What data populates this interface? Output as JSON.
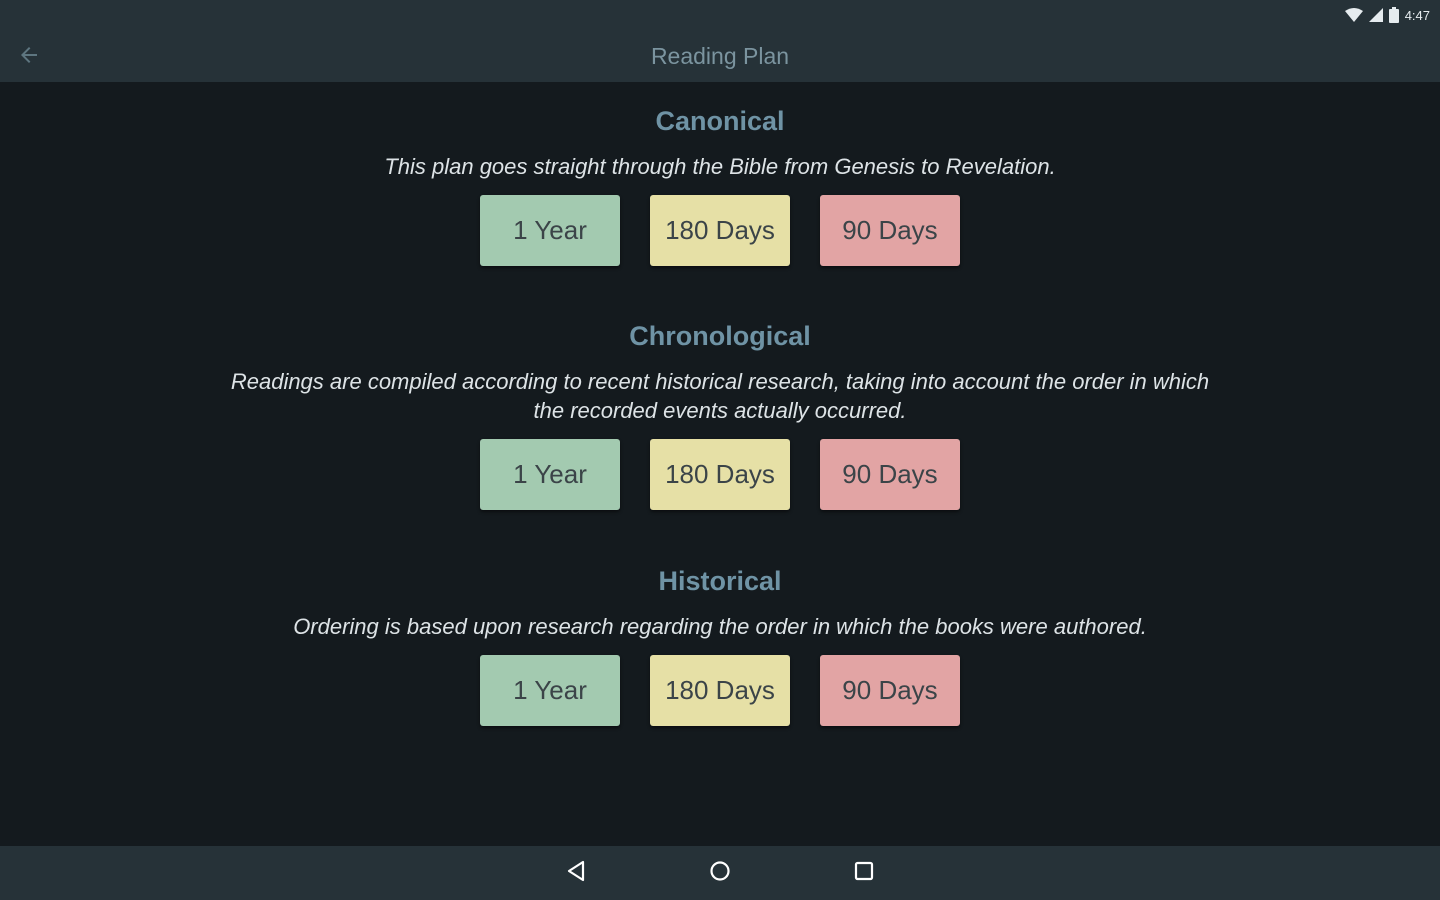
{
  "status": {
    "time": "4:47",
    "icons": [
      "wifi-icon",
      "signal-icon",
      "battery-icon"
    ]
  },
  "appbar": {
    "title": "Reading Plan",
    "back_icon": "arrow-back-icon"
  },
  "sections": [
    {
      "title": "Canonical",
      "description": "This plan goes straight through the Bible from Genesis to Revelation.",
      "buttons": [
        "1 Year",
        "180 Days",
        "90 Days"
      ]
    },
    {
      "title": "Chronological",
      "description": "Readings are compiled according to recent historical research, taking into account the order in which the recorded events actually occurred.",
      "buttons": [
        "1 Year",
        "180 Days",
        "90 Days"
      ]
    },
    {
      "title": "Historical",
      "description": "Ordering is based upon research regarding the order in which the books were authored.",
      "buttons": [
        "1 Year",
        "180 Days",
        "90 Days"
      ]
    }
  ],
  "colors": {
    "one_year": "#a3cab0",
    "days_180": "#e6e0a6",
    "days_90": "#e2a4a4",
    "title": "#6f93a5",
    "bar": "#263238",
    "background": "#141a1e"
  },
  "navbar": {
    "icons": [
      "nav-back-icon",
      "nav-home-icon",
      "nav-recents-icon"
    ]
  }
}
